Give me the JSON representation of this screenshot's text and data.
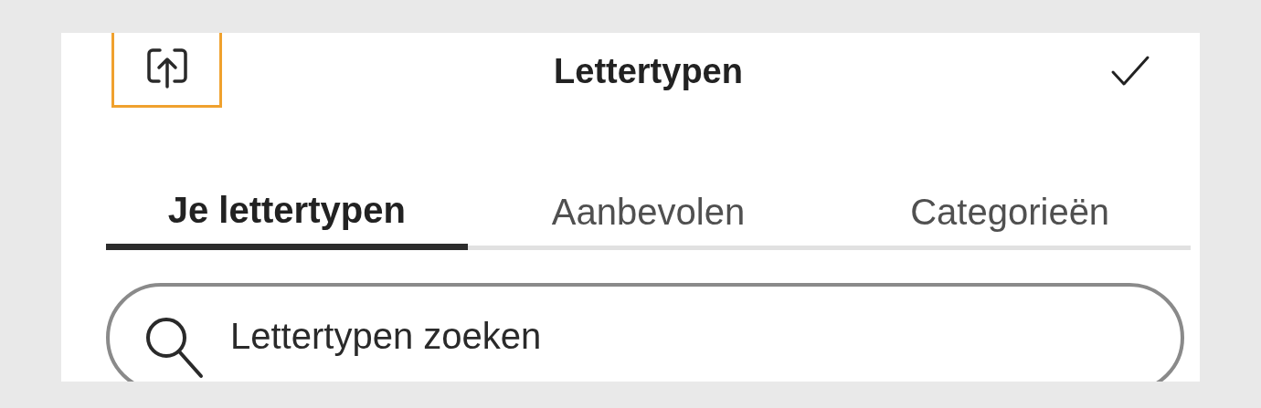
{
  "header": {
    "title": "Lettertypen",
    "upload_button": {
      "highlighted": true
    }
  },
  "tabs": [
    {
      "label": "Je lettertypen",
      "selected": true
    },
    {
      "label": "Aanbevolen",
      "selected": false
    },
    {
      "label": "Categorieën",
      "selected": false
    }
  ],
  "search": {
    "placeholder": "Lettertypen zoeken"
  }
}
